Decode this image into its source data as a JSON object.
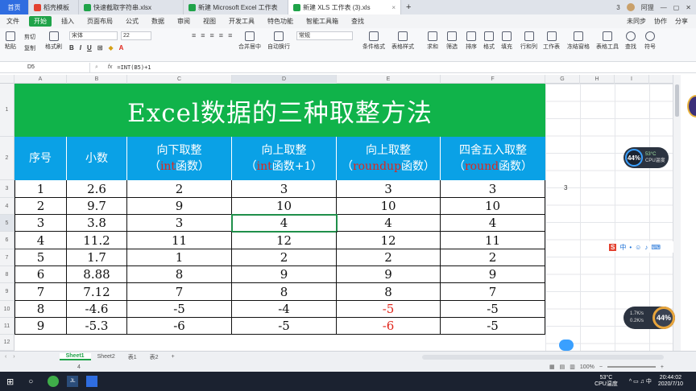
{
  "browser_tabs": [
    {
      "label": "首页",
      "type": "home"
    },
    {
      "label": "稻壳模板",
      "close": ""
    },
    {
      "label": "快速截取字符串.xlsx",
      "close": ""
    },
    {
      "label": "新建 Microsoft Excel 工作表",
      "close": ""
    },
    {
      "label": "新建 XLS 工作表 (3).xls",
      "close": "×",
      "active": true
    }
  ],
  "tabbar_right": {
    "count": "3",
    "user": "阿狸"
  },
  "ribbon_tabs": [
    "文件",
    "开始",
    "插入",
    "页面布局",
    "公式",
    "数据",
    "审阅",
    "视图",
    "开发工具",
    "特色功能",
    "智能工具箱",
    "查找"
  ],
  "ribbon_right": [
    "未同步",
    "协作",
    "分享"
  ],
  "ribbon": {
    "paste": "粘贴",
    "cut": "剪切",
    "copy": "复制",
    "format_painter": "格式刷",
    "font": "宋体",
    "size": "22",
    "merge": "合并居中",
    "wrap": "自动换行",
    "number_format": "常规",
    "cond_format": "条件格式",
    "table_style": "表格样式",
    "sum": "求和",
    "filter": "筛选",
    "sort": "排序",
    "format": "格式",
    "fill": "填充",
    "rowcol": "行和列",
    "sheet": "工作表",
    "freeze": "冻结窗格",
    "table_tools": "表格工具",
    "find": "查找",
    "symbol": "符号"
  },
  "formula_bar": {
    "cell": "D5",
    "fx": "fx",
    "formula": "=INT(B5)+1"
  },
  "columns": [
    "A",
    "B",
    "C",
    "D",
    "E",
    "F",
    "G",
    "H",
    "I"
  ],
  "rows": [
    "1",
    "2",
    "3",
    "4",
    "5",
    "6",
    "7",
    "8",
    "9",
    "10",
    "11",
    "12"
  ],
  "title": "Excel数据的三种取整方法",
  "headers": [
    {
      "l1": "序号",
      "l2": "",
      "fn": "",
      "rest": ""
    },
    {
      "l1": "小数",
      "l2": "",
      "fn": "",
      "rest": ""
    },
    {
      "l1": "向下取整",
      "l2": "（",
      "fn": "int",
      "rest": "函数）"
    },
    {
      "l1": "向上取整",
      "l2": "（",
      "fn": "int",
      "rest": "函数+1）"
    },
    {
      "l1": "向上取整",
      "l2": "（",
      "fn": "roundup",
      "rest": "函数）"
    },
    {
      "l1": "四舍五入取整",
      "l2": "（",
      "fn": "round",
      "rest": "函数）"
    }
  ],
  "rows_data": [
    [
      "1",
      "2.6",
      "2",
      "3",
      "3",
      "3"
    ],
    [
      "2",
      "9.7",
      "9",
      "10",
      "10",
      "10"
    ],
    [
      "3",
      "3.8",
      "3",
      "4",
      "4",
      "4"
    ],
    [
      "4",
      "11.2",
      "11",
      "12",
      "12",
      "11"
    ],
    [
      "5",
      "1.7",
      "1",
      "2",
      "2",
      "2"
    ],
    [
      "6",
      "8.88",
      "8",
      "9",
      "9",
      "9"
    ],
    [
      "7",
      "7.12",
      "7",
      "8",
      "8",
      "7"
    ],
    [
      "8",
      "-4.6",
      "-5",
      "-4",
      "-5",
      "-5"
    ],
    [
      "9",
      "-5.3",
      "-6",
      "-5",
      "-6",
      "-5"
    ]
  ],
  "g3_value": "3",
  "sheet_tabs": [
    "Sheet1",
    "Sheet2",
    "表1",
    "表2"
  ],
  "status": {
    "count": "4",
    "zoom": "100%"
  },
  "taskbar": {
    "temp": "53°C",
    "temp_label": "CPU温度",
    "time": "20:44:02",
    "date": "2020/7/10"
  },
  "widgets": {
    "top_pct": "44%",
    "top_temp": "53°C",
    "top_label": "CPU温度",
    "bottom_pct": "44%",
    "bottom_up": "1.7K/s",
    "bottom_down": "0.2K/s"
  },
  "colors": {
    "title_bg": "#10b34a",
    "header_bg": "#0aa1e6",
    "fn_red": "#e0261c"
  }
}
